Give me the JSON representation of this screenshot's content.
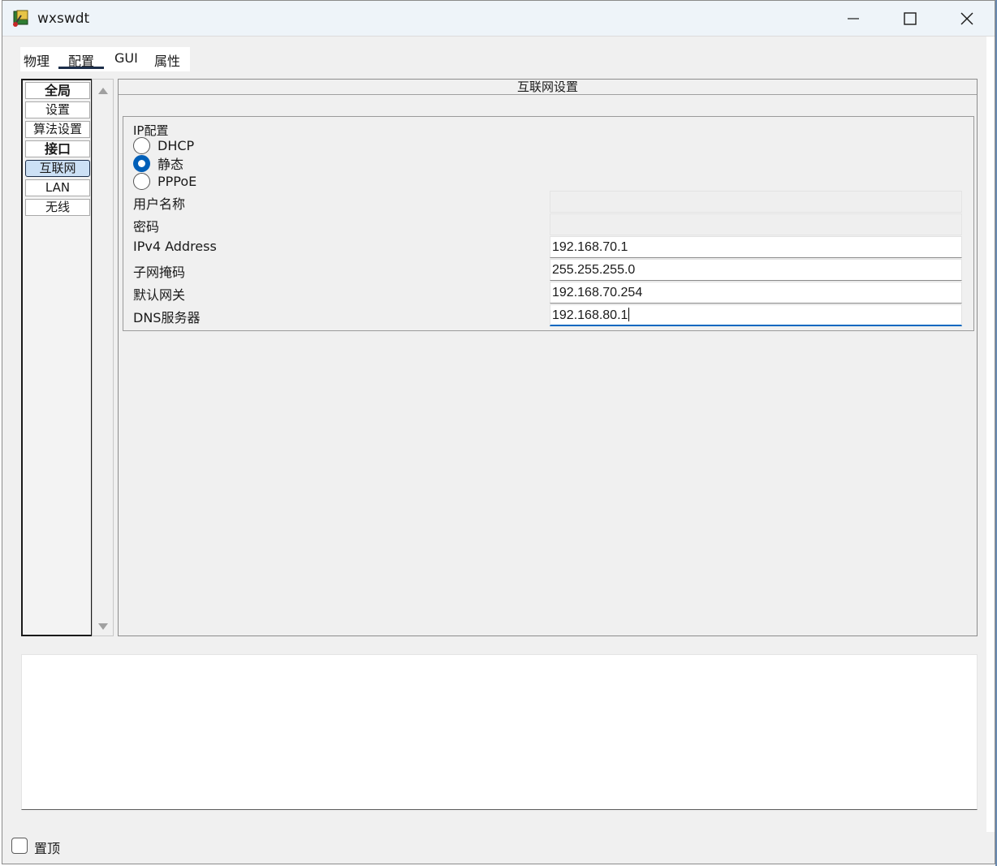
{
  "window": {
    "title": "wxswdt",
    "minimize_icon": "minimize-icon",
    "maximize_icon": "maximize-icon",
    "close_icon": "close-icon"
  },
  "tabs": [
    {
      "label": "物理",
      "active": false
    },
    {
      "label": "配置",
      "active": true
    },
    {
      "label": "GUI",
      "active": false
    },
    {
      "label": "属性",
      "active": false
    }
  ],
  "nav": {
    "items": [
      {
        "label": "全局",
        "type": "header"
      },
      {
        "label": "设置",
        "type": "item"
      },
      {
        "label": "算法设置",
        "type": "item"
      },
      {
        "label": "接口",
        "type": "header"
      },
      {
        "label": "互联网",
        "type": "item",
        "selected": true
      },
      {
        "label": "LAN",
        "type": "item"
      },
      {
        "label": "无线",
        "type": "item"
      }
    ]
  },
  "panel": {
    "title": "互联网设置",
    "ip_group": {
      "title": "IP配置",
      "options": [
        {
          "label": "DHCP",
          "checked": false
        },
        {
          "label": "静态",
          "checked": true
        },
        {
          "label": "PPPoE",
          "checked": false
        }
      ]
    },
    "fields": [
      {
        "label": "用户名称",
        "value": "",
        "disabled": true
      },
      {
        "label": "密码",
        "value": "",
        "disabled": true
      },
      {
        "label": "IPv4 Address",
        "value": "192.168.70.1",
        "disabled": false
      },
      {
        "label": "子网掩码",
        "value": "255.255.255.0",
        "disabled": false
      },
      {
        "label": "默认网关",
        "value": "192.168.70.254",
        "disabled": false
      },
      {
        "label": "DNS服务器",
        "value": "192.168.80.1",
        "disabled": false,
        "focused": true
      }
    ]
  },
  "footer": {
    "checkbox_label": "置顶",
    "checked": false
  },
  "colors": {
    "accent": "#005fb8",
    "tab_underline": "#1c2e4a",
    "nav_selected_bg": "#cce0f5"
  }
}
